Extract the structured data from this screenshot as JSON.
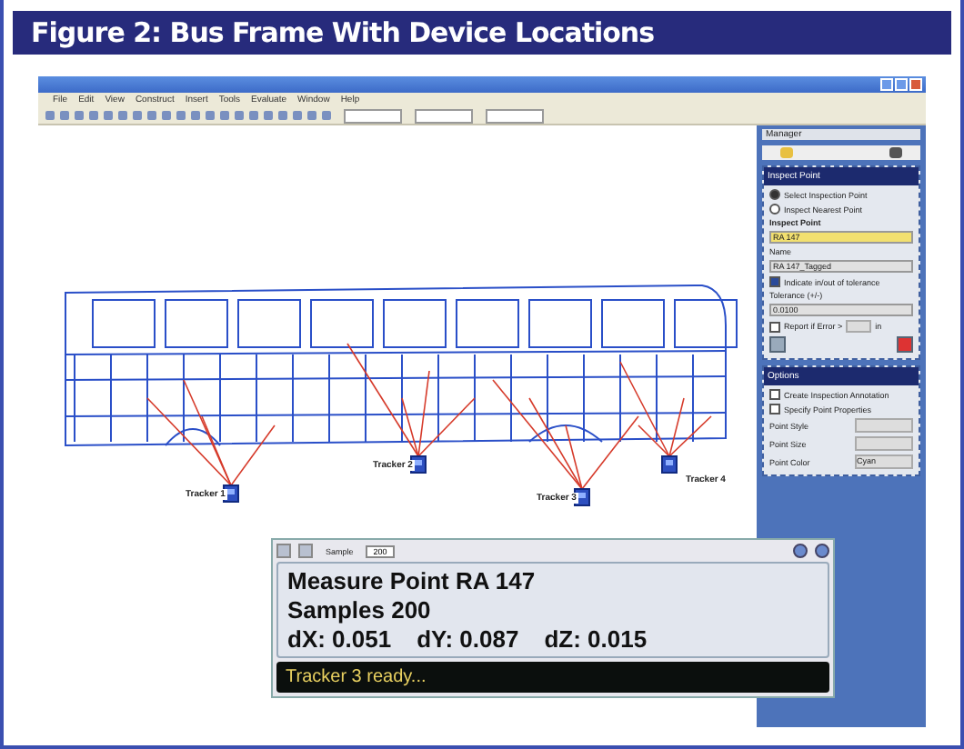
{
  "figure_title": "Figure 2: Bus Frame With Device Locations",
  "menu": [
    "File",
    "Edit",
    "View",
    "Construct",
    "Insert",
    "Tools",
    "Evaluate",
    "Window",
    "Help"
  ],
  "canvas": {
    "trackers": [
      {
        "label": "Tracker 1"
      },
      {
        "label": "Tracker 2"
      },
      {
        "label": "Tracker 3"
      },
      {
        "label": "Tracker 4"
      }
    ]
  },
  "manager": {
    "title": "Manager",
    "inspect": {
      "title": "Inspect Point",
      "modes": [
        {
          "label": "Select Inspection Point",
          "selected": true
        },
        {
          "label": "Inspect Nearest Point",
          "selected": false
        }
      ],
      "point_label": "Inspect Point",
      "point_value": "RA 147",
      "name_label": "Name",
      "name_value": "RA 147_Tagged",
      "tolerance_check": {
        "label": "Indicate in/out of tolerance",
        "checked": true
      },
      "tolerance_label": "Tolerance (+/-)",
      "tolerance_value": "0.0100",
      "report_check": {
        "label": "Report if Error >",
        "checked": false
      },
      "report_unit": "in"
    },
    "options": {
      "title": "Options",
      "checks": [
        {
          "label": "Create Inspection Annotation",
          "checked": false
        },
        {
          "label": "Specify Point Properties",
          "checked": false
        }
      ],
      "rows": [
        {
          "label": "Point Style"
        },
        {
          "label": "Point Size"
        },
        {
          "label": "Point Color",
          "value": "Cyan"
        }
      ]
    }
  },
  "measure_dialog": {
    "sample_label": "Sample",
    "sample_value": "200",
    "heading": "Measure Point RA 147",
    "samples": "Samples 200",
    "readings": [
      "dX: 0.051",
      "dY: 0.087",
      "dZ: 0.015"
    ],
    "status": "Tracker 3 ready..."
  }
}
